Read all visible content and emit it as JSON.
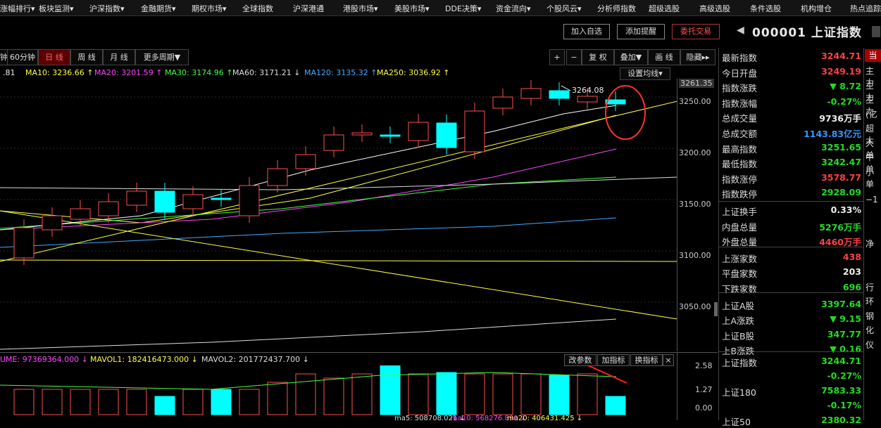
{
  "nav": [
    "涨幅排行▾",
    "板块监测▾",
    "沪深指数▾",
    "金融期货▾",
    "期权市场▾",
    "全球指数",
    "沪深港通",
    "港股市场▾",
    "美股市场▾",
    "DDE决策▾",
    "资金流向▾",
    "个股风云▾",
    "分析师指数",
    "超级选股",
    "高级选股",
    "条件选股",
    "机构增仓",
    "热点追踪"
  ],
  "actions": {
    "add_watch": "加入自选",
    "add_alert": "添加提醒",
    "trade": "委托交易"
  },
  "stock": {
    "code": "000001",
    "name": "上证指数"
  },
  "toolbar": {
    "periods": [
      "分钟",
      "60分钟",
      "日 线",
      "周 线",
      "月 线",
      "更多周期▼"
    ],
    "tools": [
      "+",
      "−",
      "复 权",
      "叠加▼",
      "画 线",
      "隐藏▸▸"
    ],
    "ma_settings": "设置均线▾"
  },
  "ma_lines": [
    {
      "text": ".81",
      "color": "#eeeeee"
    },
    {
      "text": "MA10: 3236.66 ↑",
      "color": "#ffff44"
    },
    {
      "text": "MA20: 3201.59 ↑",
      "color": "#ff44ff"
    },
    {
      "text": "MA30: 3174.96 ↑",
      "color": "#44ff44"
    },
    {
      "text": "MA60: 3171.21 ↓",
      "color": "#dddddd"
    },
    {
      "text": "MA120: 3135.32 ↑",
      "color": "#44aaff"
    },
    {
      "text": "MA250: 3036.92 ↑",
      "color": "#ffff44"
    }
  ],
  "price_axis": [
    "3261.35",
    "3250.00",
    "3200.00",
    "3150.00",
    "3100.00",
    "3050.00"
  ],
  "high_label": "3264.08",
  "volume": {
    "header": [
      "UME: 97369364.000 ↓",
      "MAVOL1: 182416473.000 ↓",
      "MAVOL2: 201772437.700 ↓"
    ],
    "header_colors": [
      "#ff44ff",
      "#ffff44",
      "#dddddd"
    ],
    "axis": [
      "2.58",
      "1.27",
      "0.00"
    ],
    "buttons": [
      "改参数",
      "加指标",
      "换指标",
      "×"
    ],
    "bottom_text": [
      "ma5: 508708.021 ↓",
      "ma10: 568276.890 ↓",
      "ma20: 406431.425 ↓"
    ]
  },
  "panel": {
    "header": "当",
    "rows": [
      {
        "label": "最新指数",
        "value": "3244.71",
        "color": "red"
      },
      {
        "label": "今日开盘",
        "value": "3249.19",
        "color": "red"
      },
      {
        "label": "指数涨跌",
        "value": "▼ 8.72",
        "color": "green"
      },
      {
        "label": "指数涨幅",
        "value": "-0.27%",
        "color": "green"
      },
      {
        "label": "总成交量",
        "value": "9736万手",
        "color": "white"
      },
      {
        "label": "总成交额",
        "value": "1143.83亿元",
        "color": "cyan"
      },
      {
        "label": "最高指数",
        "value": "3251.65",
        "color": "green"
      },
      {
        "label": "最低指数",
        "value": "3242.47",
        "color": "green"
      },
      {
        "label": "指数涨停",
        "value": "3578.77",
        "color": "red"
      },
      {
        "label": "指数跌停",
        "value": "2928.09",
        "color": "green"
      },
      {
        "label": "上证换手",
        "value": "0.33%",
        "color": "white"
      },
      {
        "label": "内盘总量",
        "value": "5276万手",
        "color": "green"
      },
      {
        "label": "外盘总量",
        "value": "4460万手",
        "color": "red"
      },
      {
        "label": "上涨家数",
        "value": "438",
        "color": "red"
      },
      {
        "label": "平盘家数",
        "value": "203",
        "color": "white"
      },
      {
        "label": "下跌家数",
        "value": "696",
        "color": "green"
      },
      {
        "label": "上证A股",
        "value": "3397.64",
        "color": "green"
      },
      {
        "label": "上A涨跌",
        "value": "▼ 9.15",
        "color": "green"
      },
      {
        "label": "上证B股",
        "value": "347.77",
        "color": "green"
      },
      {
        "label": "上B涨跌",
        "value": "▼ 0.16",
        "color": "green"
      }
    ],
    "bottom": [
      {
        "label": "上证指数",
        "value": "3244.71",
        "color": "green"
      },
      {
        "label": "",
        "value": "-0.27%",
        "color": "green"
      },
      {
        "label": "上证180",
        "value": "7583.33",
        "color": "green"
      },
      {
        "label": "",
        "value": "-0.17%",
        "color": "green"
      },
      {
        "label": "上证50",
        "value": "2380.32",
        "color": "green"
      }
    ]
  },
  "far_right": [
    "主力",
    "主力",
    "主力",
    "(亿",
    "超大",
    "大单",
    "中单",
    "小单",
    "",
    "−1",
    "",
    "",
    "净",
    "",
    "",
    "行",
    "环",
    "钢",
    "化",
    "仪"
  ]
}
